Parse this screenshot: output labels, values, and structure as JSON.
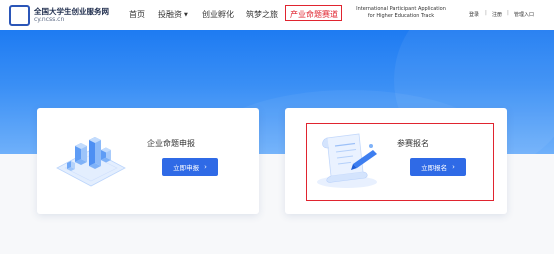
{
  "header": {
    "logo_mark": "",
    "logo_title": "全国大学生创业服务网",
    "logo_subtitle": "cy.ncss.cn",
    "nav": [
      {
        "label": "首页"
      },
      {
        "label": "投融资",
        "has_dropdown": true
      },
      {
        "label": "创业孵化"
      },
      {
        "label": "筑梦之旅"
      },
      {
        "label": "产业命题赛道",
        "active": true
      }
    ],
    "intl_line1": "International Participant Application",
    "intl_line2": "for Higher Education Track",
    "login": "登录",
    "register": "注册",
    "admin": "管理入口",
    "separator": "|"
  },
  "cards": [
    {
      "title": "企业命题申报",
      "button": "立即申报",
      "chevron": "›",
      "illustration": "isometric-city-icon"
    },
    {
      "title": "参赛报名",
      "button": "立即报名",
      "chevron": "›",
      "illustration": "document-scroll-icon"
    }
  ],
  "colors": {
    "brand": "#2b56b8",
    "active_nav": "#e0242f",
    "hero_top": "#1e7bf2",
    "hero_bottom": "#6fb0fa",
    "button": "#2f6ae6",
    "annotation": "#e0242f"
  }
}
